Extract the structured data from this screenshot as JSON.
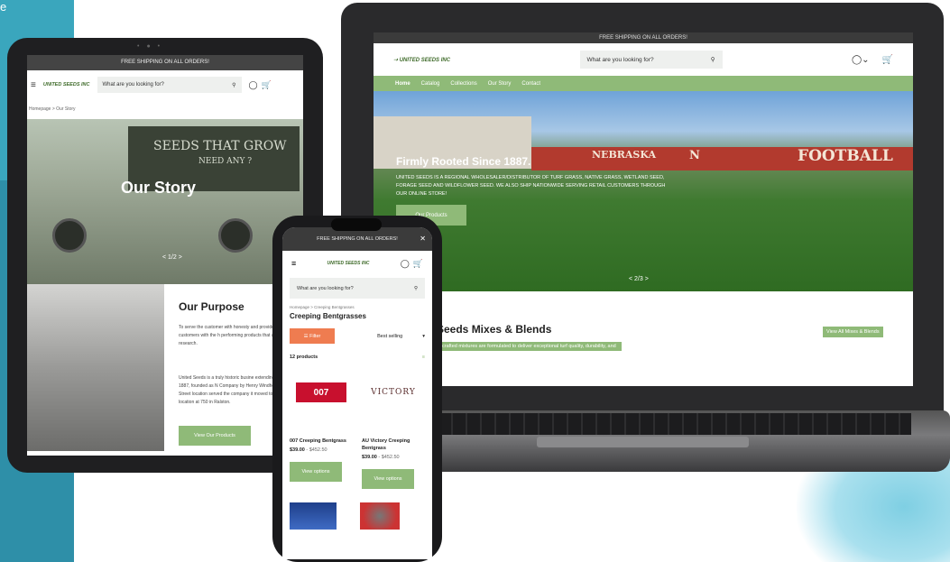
{
  "laptop": {
    "topbar": "FREE SHIPPING ON ALL ORDERS!",
    "logo": "UNITED SEEDS INC",
    "search_placeholder": "What are you looking for?",
    "nav": [
      "Home",
      "Catalog",
      "Collections",
      "Our Story",
      "Contact"
    ],
    "hero_title": "Firmly Rooted Since 1887.",
    "hero_sub": "UNITED SEEDS IS A REGIONAL WHOLESALER/DISTRIBUTOR OF TURF GRASS, NATIVE GRASS, WETLAND SEED, FORAGE SEED AND WILDFLOWER SEED. WE ALSO SHIP NATIONWIDE SERVING RETAIL CUSTOMERS THROUGH OUR ONLINE STORE!",
    "hero_button": "Our Products",
    "wall_left": "NEBRASKA",
    "wall_mid": "N",
    "wall_right": "FOOTBALL",
    "pager": "< 2/3 >",
    "section_title": "Seeds Mixes & Blends",
    "section_sub": "crafted mixtures are formulated to deliver exceptional turf quality, durability, and",
    "section_button": "View All Mixes & Blends",
    "cart_count": "0"
  },
  "tablet": {
    "topbar": "FREE SHIPPING ON ALL ORDERS!",
    "logo": "UNITED SEEDS INC",
    "search_placeholder": "What are you looking for?",
    "breadcrumb": "Homepage > Our Story",
    "hero_title": "Our Story",
    "truck_text": "SEEDS THAT GROW",
    "truck_text2": "NEED ANY ?",
    "pager": "< 1/2 >",
    "purpose_title": "Our Purpose",
    "purpose_text": "To serve the customer with honesty and provide our customers with the h performing products that are proven research.",
    "purpose_text2": "United Seeds is a truly historic busine extending back to 1887, founded as N Company by Henry Windheim. The 12 Street location served the company it moved to its present location at 750 in Ralston.",
    "purpose_button": "View Our Products"
  },
  "phone": {
    "topbar": "FREE SHIPPING ON ALL ORDERS!",
    "logo": "UNITED SEEDS INC",
    "search_placeholder": "What are you looking for?",
    "breadcrumb": "Homepage > Creeping Bentgrasses",
    "title": "Creeping Bentgrasses",
    "filter_label": "Filter",
    "sort_label": "Best selling",
    "product_count": "12 products",
    "products": [
      {
        "name": "007 Creeping Bentgrass",
        "price": "$39.00",
        "price_range": "- $452.50",
        "button": "View options",
        "brand": "007"
      },
      {
        "name": "AU Victory Creeping Bentgrass",
        "price": "$39.00",
        "price_range": "- $452.50",
        "button": "View options",
        "brand": "VICTORY"
      }
    ]
  },
  "colors": {
    "accent_green": "#8fba78",
    "filter_orange": "#ef7c50",
    "background_teal": "#2e8fa8"
  }
}
